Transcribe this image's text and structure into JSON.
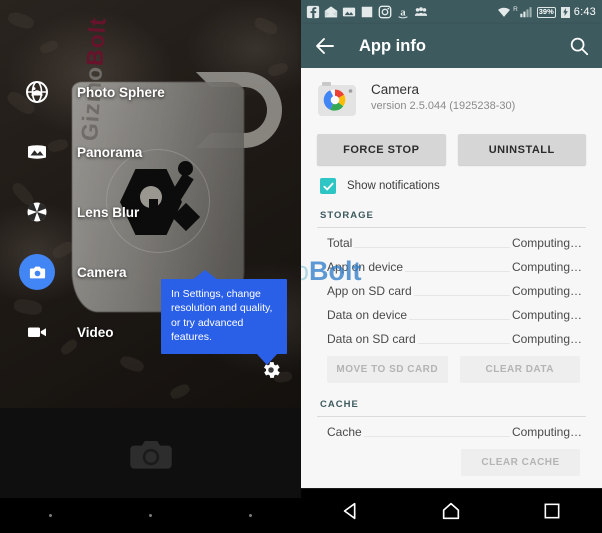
{
  "left": {
    "panel_name": "camera-app",
    "modes": [
      {
        "label": "Photo Sphere",
        "icon": "photo-sphere-icon",
        "active": false
      },
      {
        "label": "Panorama",
        "icon": "panorama-icon",
        "active": false
      },
      {
        "label": "Lens Blur",
        "icon": "lens-blur-icon",
        "active": false
      },
      {
        "label": "Camera",
        "icon": "camera-icon",
        "active": true
      },
      {
        "label": "Video",
        "icon": "video-icon",
        "active": false
      }
    ],
    "tooltip": {
      "text": "In Settings, change resolution and quality, or try advanced features.",
      "color": "#2a5fe8"
    },
    "settings_icon": "gear-icon",
    "shutter_icon": "camera-shutter-icon",
    "accent_color": "#4285f4",
    "mug_watermark": {
      "part1": "Gizmo",
      "part2": "Bolt"
    }
  },
  "watermark": {
    "part1": "Gizmo",
    "part2": "Bolt"
  },
  "right": {
    "statusbar": {
      "notification_icons": [
        "facebook-icon",
        "mail-icon",
        "photo-icon",
        "blank-square-icon",
        "instagram-icon",
        "amazon-icon",
        "people-icon"
      ],
      "wifi_icon": "wifi-icon",
      "signal_icon": "cell-signal-icon",
      "roaming_indicator": "R",
      "battery_percent": "39%",
      "battery_icon": "battery-charging-icon",
      "time": "6:43",
      "background": "#3d5a5e"
    },
    "appbar": {
      "back_icon": "back-arrow-icon",
      "title": "App info",
      "search_icon": "search-icon"
    },
    "app": {
      "icon": "google-camera-icon",
      "name": "Camera",
      "version": "version 2.5.044 (1925238-30)"
    },
    "actions": {
      "force_stop": "FORCE STOP",
      "uninstall": "UNINSTALL"
    },
    "notifications": {
      "label": "Show notifications",
      "checked": true,
      "check_color": "#2ec5c5"
    },
    "storage": {
      "title": "STORAGE",
      "rows": [
        {
          "label": "Total",
          "value": "Computing…"
        },
        {
          "label": "App on device",
          "value": "Computing…"
        },
        {
          "label": "App on SD card",
          "value": "Computing…"
        },
        {
          "label": "Data on device",
          "value": "Computing…"
        },
        {
          "label": "Data on SD card",
          "value": "Computing…"
        }
      ],
      "move_to_sd": "MOVE TO SD CARD",
      "clear_data": "CLEAR DATA"
    },
    "cache": {
      "title": "CACHE",
      "rows": [
        {
          "label": "Cache",
          "value": "Computing…"
        }
      ],
      "clear_cache": "CLEAR CACHE"
    },
    "navbar": {
      "back_icon": "nav-back-icon",
      "home_icon": "nav-home-icon",
      "recents_icon": "nav-recents-icon"
    }
  }
}
